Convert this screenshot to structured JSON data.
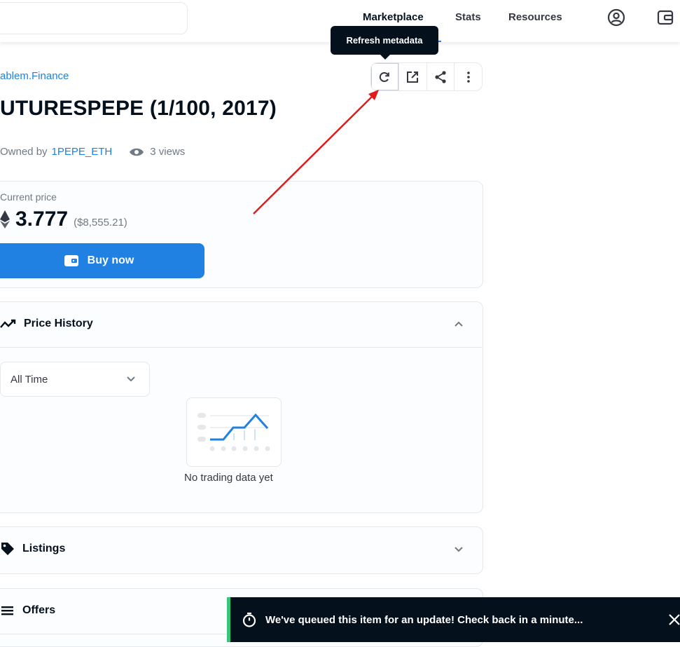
{
  "nav": {
    "links": [
      "Marketplace",
      "Stats",
      "Resources"
    ]
  },
  "tooltip": {
    "text": "Refresh metadata"
  },
  "item": {
    "collection": "ablem.Finance",
    "title": "UTURESPEPE (1/100, 2017)",
    "owned_by_label": "Owned by",
    "owner": "1PEPE_ETH",
    "views": "3 views"
  },
  "price": {
    "label": "Current price",
    "value": "3.777",
    "usd": "($8,555.21)",
    "buy_label": "Buy now"
  },
  "price_history": {
    "title": "Price History",
    "range": "All Time",
    "empty_text": "No trading data yet"
  },
  "sections": {
    "listings": "Listings",
    "offers": "Offers"
  },
  "toast": {
    "text": "We've queued this item for an update! Check back in a minute..."
  },
  "colors": {
    "accent": "#2081e2",
    "dark": "#04111d",
    "annotation_arrow": "#e3191b",
    "toast_stripe": "#34c77b"
  }
}
